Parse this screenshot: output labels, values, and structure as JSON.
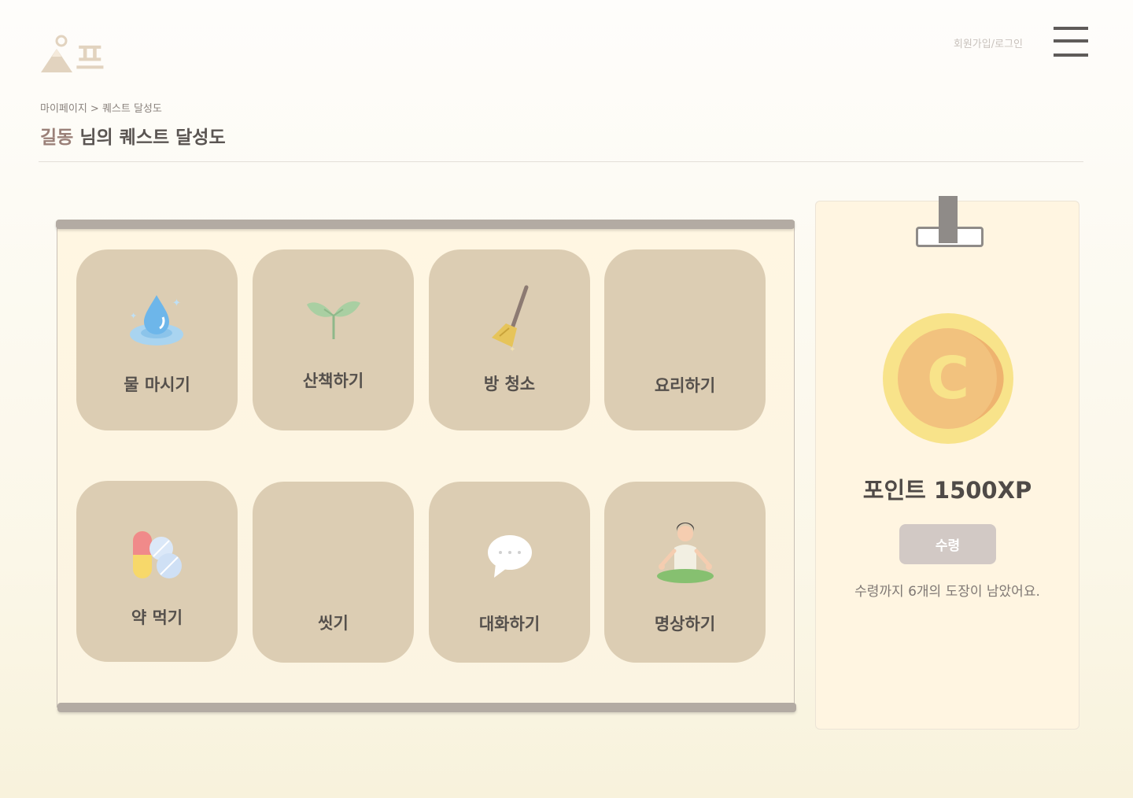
{
  "header": {
    "logo_text": "프",
    "auth_link": "회원가입/로그인"
  },
  "breadcrumb": "마이페이지 > 퀘스트 달성도",
  "title": {
    "name": "길동",
    "suffix": " 님의 퀘스트 달성도"
  },
  "quests": [
    {
      "label": "물 마시기",
      "icon": "water-drop-icon"
    },
    {
      "label": "산책하기",
      "icon": "sprout-icon"
    },
    {
      "label": "방 청소",
      "icon": "broom-icon"
    },
    {
      "label": "요리하기",
      "icon": ""
    },
    {
      "label": "약 먹기",
      "icon": "pills-icon"
    },
    {
      "label": "씻기",
      "icon": ""
    },
    {
      "label": "대화하기",
      "icon": "speech-bubble-icon"
    },
    {
      "label": "명상하기",
      "icon": "meditation-icon"
    }
  ],
  "panel": {
    "coin_letter": "C",
    "points": "포인트 1500XP",
    "claim_button": "수령",
    "remaining_text": "수령까지 6개의 도장이 남았어요."
  },
  "colors": {
    "accent_name": "#9a8078",
    "quest_tile": "#dccdb3",
    "coin_outer": "#f8e38a",
    "coin_inner": "#f2c27e"
  }
}
